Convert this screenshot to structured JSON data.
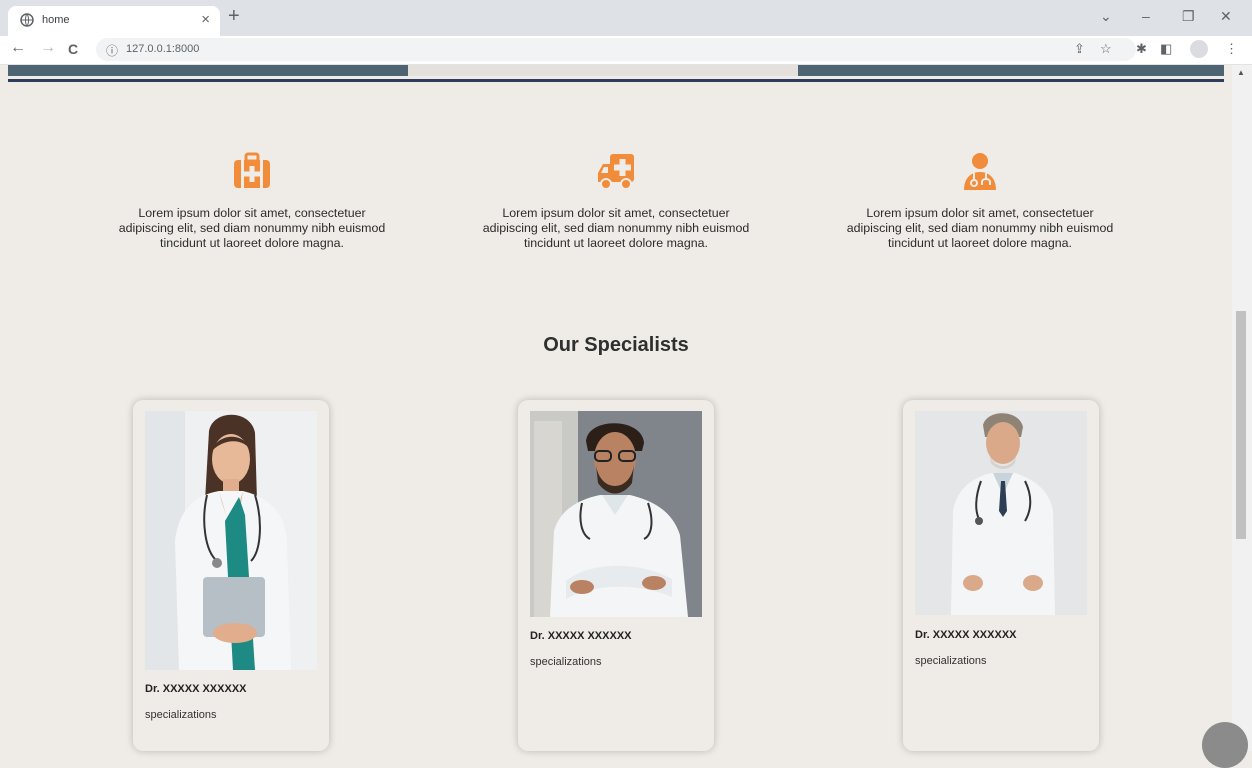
{
  "browser": {
    "tab_title": "home",
    "tab_close": "×",
    "new_tab": "+",
    "url": "127.0.0.1:8000",
    "nav": {
      "back": "←",
      "forward": "→",
      "reload": "C"
    }
  },
  "features": [
    {
      "icon": "medical-kit-icon",
      "text": "Lorem ipsum dolor sit amet, consectetuer adipiscing elit, sed diam nonummy nibh euismod tincidunt ut laoreet dolore magna."
    },
    {
      "icon": "ambulance-icon",
      "text": "Lorem ipsum dolor sit amet, consectetuer adipiscing elit, sed diam nonummy nibh euismod tincidunt ut laoreet dolore magna."
    },
    {
      "icon": "doctor-icon",
      "text": "Lorem ipsum dolor sit amet, consectetuer adipiscing elit, sed diam nonummy nibh euismod tincidunt ut laoreet dolore magna."
    }
  ],
  "specialists": {
    "title": "Our Specialists",
    "doctors": [
      {
        "name": "Dr. XXXXX XXXXXX",
        "specialization": "specializations"
      },
      {
        "name": "Dr. XXXXX XXXXXX",
        "specialization": "specializations"
      },
      {
        "name": "Dr. XXXXX XXXXXX",
        "specialization": "specializations"
      }
    ]
  },
  "colors": {
    "accent": "#f08c3a",
    "page_bg": "#efebe6",
    "hero_bar": "#4f6472",
    "divider": "#2f3d5c"
  }
}
